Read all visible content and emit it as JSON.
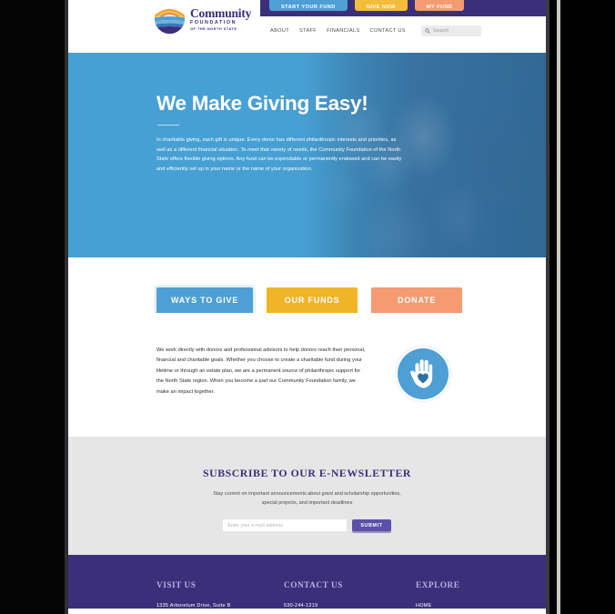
{
  "header": {
    "logo": {
      "mark": "sun-waves-circle-logo",
      "title": "Community",
      "sub1": "FOUNDATION",
      "sub2": "OF THE NORTH STATE"
    },
    "top_buttons": [
      {
        "label": "START YOUR FUND",
        "color": "#4d9fd4"
      },
      {
        "label": "GIVE NOW",
        "color": "#f3bc3a"
      },
      {
        "label": "MY FUND",
        "color": "#f49b72"
      }
    ],
    "nav": [
      {
        "label": "ABOUT"
      },
      {
        "label": "STAFF"
      },
      {
        "label": "FINANCIALS"
      },
      {
        "label": "CONTACT US"
      }
    ],
    "search": {
      "icon": "search-icon",
      "placeholder": "Search",
      "value": ""
    }
  },
  "hero": {
    "title": "We Make Giving Easy!",
    "copy": "In charitable giving, each gift is unique. Every donor has different philanthropic interests and priorities, as well as a different financial situation. To meet that variety of needs, the Community Foundation of the North State offers flexible giving options. Any fund can be expendable or permanently endowed and can be easily and efficiently set up in your name or the name of your organization.",
    "image": "two-women-embracing-photo",
    "overlay_color": "#47a0d4"
  },
  "cta_buttons": [
    {
      "label": "WAYS TO GIVE",
      "color": "#4d9fd4"
    },
    {
      "label": "OUR FUNDS",
      "color": "#f0b429"
    },
    {
      "label": "DONATE",
      "color": "#f49b72"
    }
  ],
  "intro": {
    "copy": "We work directly with donors and professional advisors to help donors reach their personal, financial and charitable goals. Whether you choose to create a charitable fund during your lifetime or through an estate plan, we are a permanent source of philanthropic support for the North State region. When you become a part our Community Foundation family, we make an impact together.",
    "icon": "hand-heart-icon",
    "icon_color": "#4d9fd4"
  },
  "newsletter": {
    "title": "SUBSCRIBE TO OUR E-NEWSLETTER",
    "subtitle": "Stay current on important announcements about grant and scholarship opportunities, special projects, and important deadlines",
    "input_placeholder": "Enter your e-mail address",
    "input_value": "",
    "submit_label": "SUBMIT",
    "submit_color": "#5b50aa",
    "background": "#e6e6e6"
  },
  "footer": {
    "background": "#3c2f7a",
    "columns": [
      {
        "heading": "VISIT US",
        "items": [
          {
            "text": "1335 Arboretum Drive, Suite B"
          }
        ]
      },
      {
        "heading": "CONTACT US",
        "items": [
          {
            "text": "530-244-1219"
          }
        ]
      },
      {
        "heading": "EXPLORE",
        "items": [
          {
            "text": "HOME"
          }
        ]
      }
    ]
  }
}
